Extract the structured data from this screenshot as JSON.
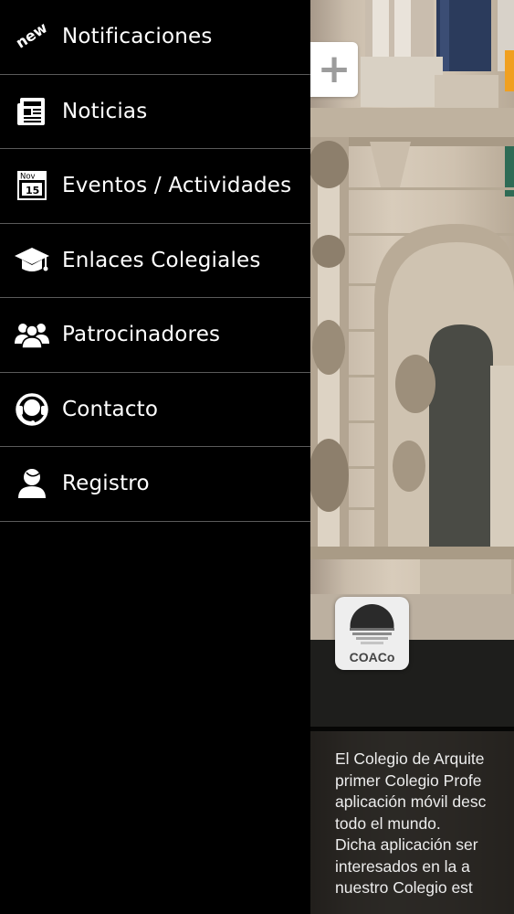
{
  "menu": {
    "items": [
      {
        "icon": "new-badge-icon",
        "badge": "new",
        "label": "Notificaciones"
      },
      {
        "icon": "newspaper-icon",
        "label": "Noticias"
      },
      {
        "icon": "calendar-icon",
        "calendar_month": "Nov",
        "calendar_day": "15",
        "label": "Eventos / Actividades"
      },
      {
        "icon": "graduation-cap-icon",
        "label": "Enlaces Colegiales"
      },
      {
        "icon": "group-icon",
        "label": "Patrocinadores"
      },
      {
        "icon": "headset-icon",
        "label": "Contacto"
      },
      {
        "icon": "user-icon",
        "label": "Registro"
      }
    ]
  },
  "content": {
    "add_button": "+",
    "logo_text": "COACo",
    "description_lines": [
      "El Colegio de Arquite",
      "primer Colegio Profe",
      "aplicación móvil desc",
      "todo el mundo.",
      "Dicha aplicación ser",
      "interesados en la a",
      "nuestro Colegio est"
    ]
  },
  "colors": {
    "drawer_background": "#000000",
    "divider": "#5a5a5a",
    "menu_text": "#ffffff"
  }
}
